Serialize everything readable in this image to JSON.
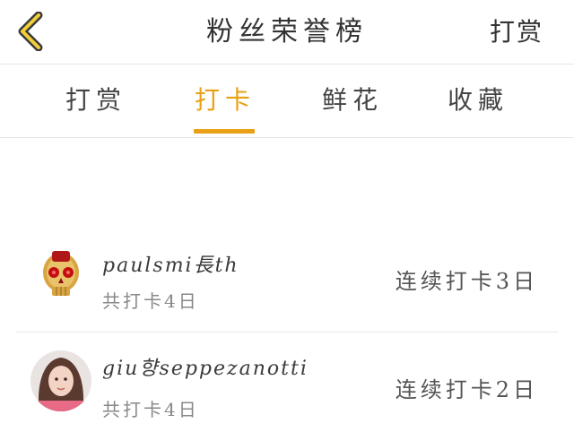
{
  "header": {
    "title": "粉丝荣誉榜",
    "action_label": "打赏",
    "back_icon": "chevron-left-icon",
    "accent_color": "#e8a117"
  },
  "tabs": [
    {
      "label": "打赏",
      "active": false
    },
    {
      "label": "打卡",
      "active": true
    },
    {
      "label": "鲜花",
      "active": false
    },
    {
      "label": "收藏",
      "active": false
    }
  ],
  "list": [
    {
      "username": "paulsmi長th",
      "total": "共打卡4日",
      "streak": "连续打卡3日",
      "avatar_icon": "skull-avatar"
    },
    {
      "username": "giu향seppezanotti",
      "total": "共打卡4日",
      "streak": "连续打卡2日",
      "avatar_icon": "portrait-avatar"
    }
  ]
}
